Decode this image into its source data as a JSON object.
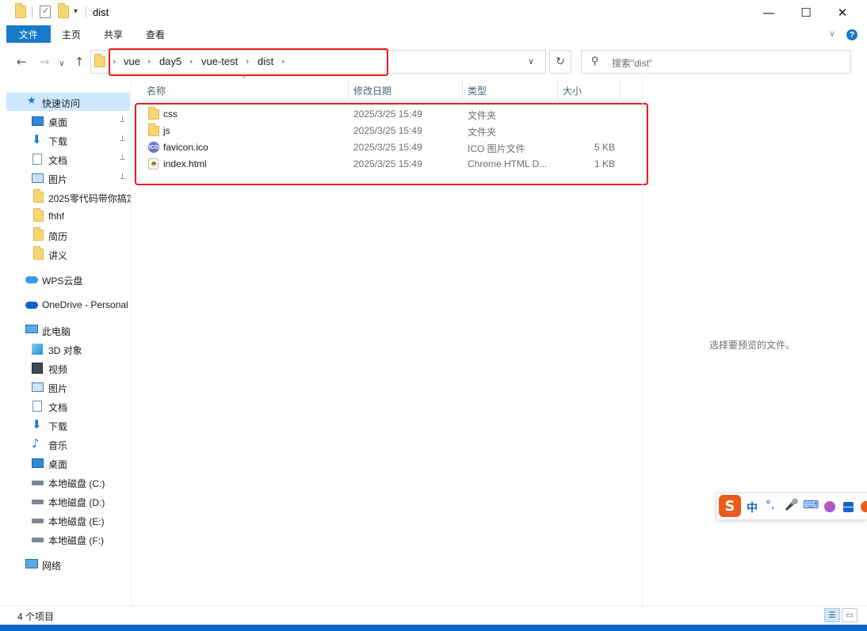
{
  "window": {
    "title": "dist",
    "minimize": "—",
    "maximize": "☐",
    "close": "✕"
  },
  "ribbon": {
    "tabs": [
      "文件",
      "主页",
      "共享",
      "查看"
    ],
    "collapse": "∨",
    "help": "?"
  },
  "nav_buttons": {
    "back": "←",
    "forward": "→",
    "recent": "∨",
    "up": "↑"
  },
  "address": {
    "crumbs": [
      "vue",
      "day5",
      "vue-test",
      "dist"
    ],
    "separator": "›",
    "dropdown": "∨",
    "refresh": "↻"
  },
  "search": {
    "placeholder": "搜索\"dist\"",
    "icon": "search-icon"
  },
  "columns": {
    "name": "名称",
    "modified": "修改日期",
    "type": "类型",
    "size": "大小"
  },
  "files": [
    {
      "name": "css",
      "modified": "2025/3/25 15:49",
      "type": "文件夹",
      "size": "",
      "icon": "folder-icon"
    },
    {
      "name": "js",
      "modified": "2025/3/25 15:49",
      "type": "文件夹",
      "size": "",
      "icon": "folder-icon"
    },
    {
      "name": "favicon.ico",
      "modified": "2025/3/25 15:49",
      "type": "ICO 图片文件",
      "size": "5 KB",
      "icon": "ico-file-icon"
    },
    {
      "name": "index.html",
      "modified": "2025/3/25 15:49",
      "type": "Chrome HTML D...",
      "size": "1 KB",
      "icon": "chrome-html-icon"
    }
  ],
  "nav": {
    "quick_access": "快速访问",
    "quick_items": [
      {
        "label": "桌面",
        "icon": "desktop-icon",
        "pinned": true
      },
      {
        "label": "下载",
        "icon": "download-icon",
        "pinned": true
      },
      {
        "label": "文档",
        "icon": "documents-icon",
        "pinned": true
      },
      {
        "label": "图片",
        "icon": "pictures-icon",
        "pinned": true
      },
      {
        "label": "2025零代码带你搞定",
        "icon": "folder-icon",
        "pinned": false
      },
      {
        "label": "fhhf",
        "icon": "folder-icon",
        "pinned": false
      },
      {
        "label": "简历",
        "icon": "folder-icon",
        "pinned": false
      },
      {
        "label": "讲义",
        "icon": "folder-icon",
        "pinned": false
      }
    ],
    "wps": "WPS云盘",
    "onedrive": "OneDrive - Personal",
    "this_pc": "此电脑",
    "pc_items": [
      {
        "label": "3D 对象",
        "icon": "3d-objects-icon"
      },
      {
        "label": "视频",
        "icon": "videos-icon"
      },
      {
        "label": "图片",
        "icon": "pictures-icon"
      },
      {
        "label": "文档",
        "icon": "documents-icon"
      },
      {
        "label": "下载",
        "icon": "download-icon"
      },
      {
        "label": "音乐",
        "icon": "music-icon"
      },
      {
        "label": "桌面",
        "icon": "desktop-icon"
      },
      {
        "label": "本地磁盘 (C:)",
        "icon": "system-drive-icon"
      },
      {
        "label": "本地磁盘 (D:)",
        "icon": "drive-icon"
      },
      {
        "label": "本地磁盘 (E:)",
        "icon": "drive-icon"
      },
      {
        "label": "本地磁盘 (F:)",
        "icon": "drive-icon"
      }
    ],
    "network": "网络",
    "pin_glyph": "📌"
  },
  "preview": {
    "message": "选择要预览的文件。"
  },
  "ime": {
    "logo": "S",
    "mode": "中",
    "punct": "°,",
    "mic": "🎤",
    "keyboard": "⌨"
  },
  "status": {
    "count": "4 个项目"
  },
  "colors": {
    "accent": "#1979ca",
    "highlight": "#e81c1c",
    "selection": "#cce8ff"
  }
}
